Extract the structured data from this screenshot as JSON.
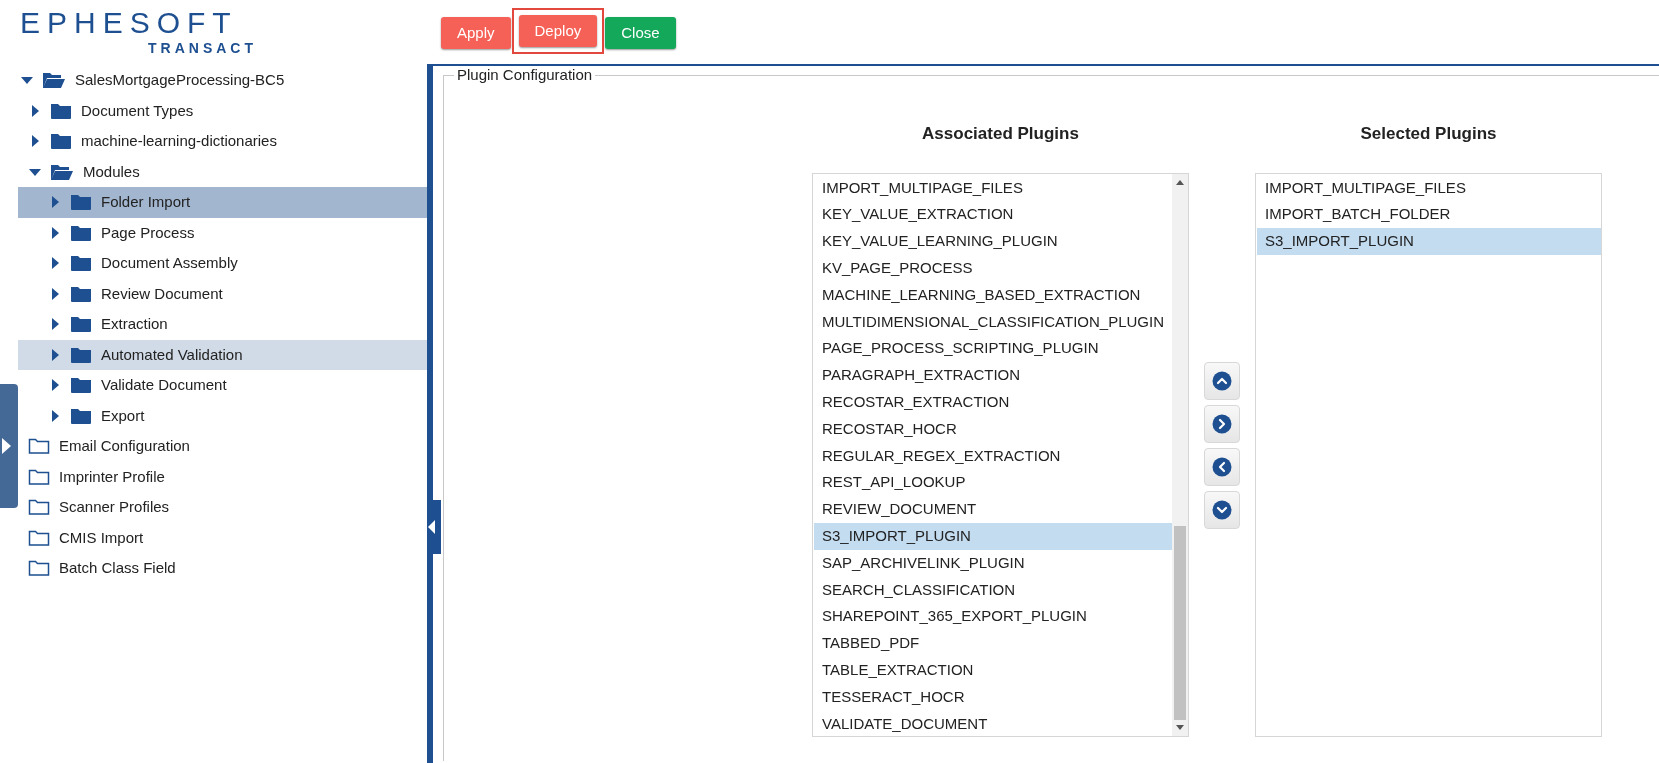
{
  "logo": {
    "name": "EPHESOFT",
    "subtitle": "TRANSACT"
  },
  "toolbar": {
    "buttons": [
      {
        "label": "Apply",
        "kind": "danger",
        "focused": false
      },
      {
        "label": "Deploy",
        "kind": "danger",
        "focused": true
      },
      {
        "label": "Close",
        "kind": "success",
        "focused": false
      }
    ]
  },
  "tree": [
    {
      "label": "SalesMortgageProcessing-BC5",
      "kind": "branch",
      "expanded": true,
      "selected": false,
      "hovered": false,
      "children": [
        {
          "label": "Document Types",
          "kind": "branch",
          "expanded": false,
          "selected": false,
          "hovered": false
        },
        {
          "label": "machine-learning-dictionaries",
          "kind": "branch",
          "expanded": false,
          "selected": false,
          "hovered": false
        },
        {
          "label": "Modules",
          "kind": "branch",
          "expanded": true,
          "selected": false,
          "hovered": false,
          "children": [
            {
              "label": "Folder Import",
              "kind": "branch",
              "expanded": false,
              "selected": true,
              "hovered": false
            },
            {
              "label": "Page Process",
              "kind": "branch",
              "expanded": false,
              "selected": false,
              "hovered": false
            },
            {
              "label": "Document Assembly",
              "kind": "branch",
              "expanded": false,
              "selected": false,
              "hovered": false
            },
            {
              "label": "Review Document",
              "kind": "branch",
              "expanded": false,
              "selected": false,
              "hovered": false
            },
            {
              "label": "Extraction",
              "kind": "branch",
              "expanded": false,
              "selected": false,
              "hovered": false
            },
            {
              "label": "Automated Validation",
              "kind": "branch",
              "expanded": false,
              "selected": false,
              "hovered": true
            },
            {
              "label": "Validate Document",
              "kind": "branch",
              "expanded": false,
              "selected": false,
              "hovered": false
            },
            {
              "label": "Export",
              "kind": "branch",
              "expanded": false,
              "selected": false,
              "hovered": false
            }
          ]
        },
        {
          "label": "Email Configuration",
          "kind": "leaf",
          "selected": false,
          "hovered": false
        },
        {
          "label": "Imprinter Profile",
          "kind": "leaf",
          "selected": false,
          "hovered": false
        },
        {
          "label": "Scanner Profiles",
          "kind": "leaf",
          "selected": false,
          "hovered": false
        },
        {
          "label": "CMIS Import",
          "kind": "leaf",
          "selected": false,
          "hovered": false
        },
        {
          "label": "Batch Class Field",
          "kind": "leaf",
          "selected": false,
          "hovered": false
        }
      ]
    }
  ],
  "panel": {
    "legend": "Plugin Configuration",
    "associated": {
      "title": "Associated Plugins",
      "items": [
        {
          "label": "IMPORT_MULTIPAGE_FILES",
          "selected": false
        },
        {
          "label": "KEY_VALUE_EXTRACTION",
          "selected": false
        },
        {
          "label": "KEY_VALUE_LEARNING_PLUGIN",
          "selected": false
        },
        {
          "label": "KV_PAGE_PROCESS",
          "selected": false
        },
        {
          "label": "MACHINE_LEARNING_BASED_EXTRACTION",
          "selected": false
        },
        {
          "label": "MULTIDIMENSIONAL_CLASSIFICATION_PLUGIN",
          "selected": false
        },
        {
          "label": "PAGE_PROCESS_SCRIPTING_PLUGIN",
          "selected": false
        },
        {
          "label": "PARAGRAPH_EXTRACTION",
          "selected": false
        },
        {
          "label": "RECOSTAR_EXTRACTION",
          "selected": false
        },
        {
          "label": "RECOSTAR_HOCR",
          "selected": false
        },
        {
          "label": "REGULAR_REGEX_EXTRACTION",
          "selected": false
        },
        {
          "label": "REST_API_LOOKUP",
          "selected": false
        },
        {
          "label": "REVIEW_DOCUMENT",
          "selected": false
        },
        {
          "label": "S3_IMPORT_PLUGIN",
          "selected": true
        },
        {
          "label": "SAP_ARCHIVELINK_PLUGIN",
          "selected": false
        },
        {
          "label": "SEARCH_CLASSIFICATION",
          "selected": false
        },
        {
          "label": "SHAREPOINT_365_EXPORT_PLUGIN",
          "selected": false
        },
        {
          "label": "TABBED_PDF",
          "selected": false
        },
        {
          "label": "TABLE_EXTRACTION",
          "selected": false
        },
        {
          "label": "TESSERACT_HOCR",
          "selected": false
        },
        {
          "label": "VALIDATE_DOCUMENT",
          "selected": false
        }
      ]
    },
    "selected_list": {
      "title": "Selected Plugins",
      "items": [
        {
          "label": "IMPORT_MULTIPAGE_FILES",
          "selected": false
        },
        {
          "label": "IMPORT_BATCH_FOLDER",
          "selected": false
        },
        {
          "label": "S3_IMPORT_PLUGIN",
          "selected": true
        }
      ]
    }
  }
}
